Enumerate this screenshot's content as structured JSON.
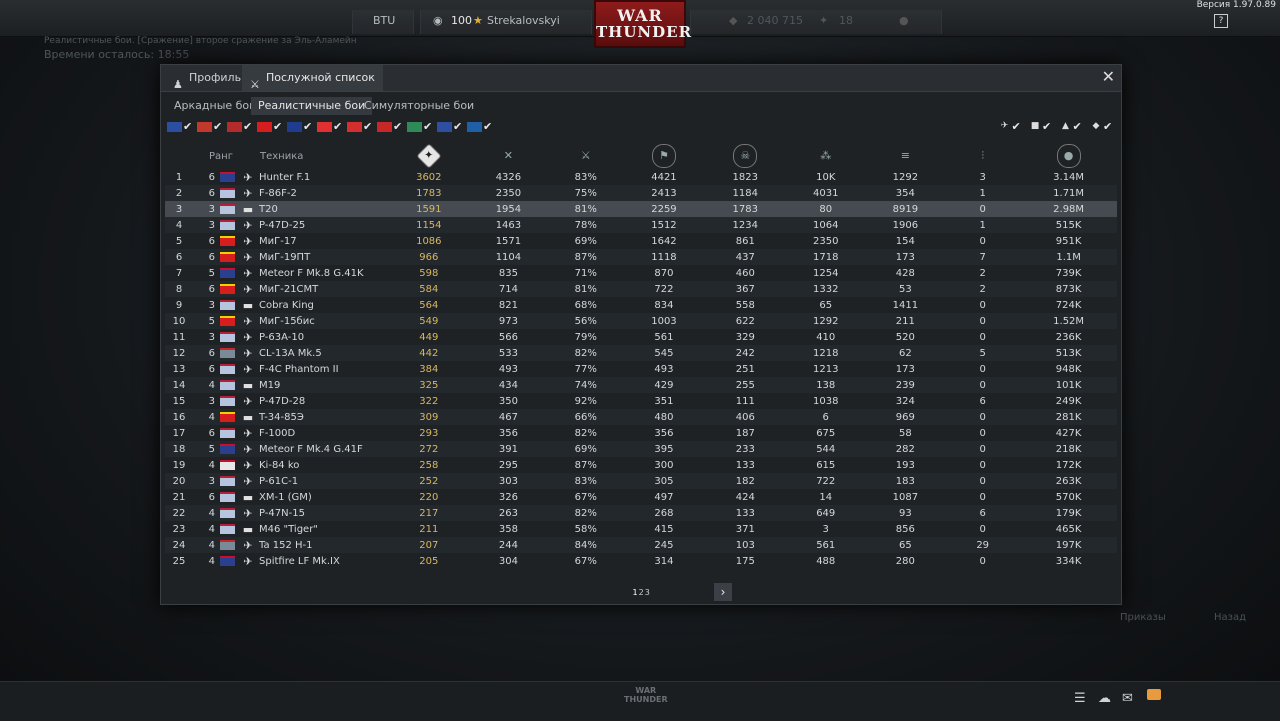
{
  "topbar": {
    "version": "Версия 1.97.0.89",
    "currency_label": "BTU",
    "player_level": "100",
    "player_name": "Strekalovskyi",
    "lions": "2 040 715",
    "eagles": "18",
    "logo_line1": "WAR",
    "logo_line2": "THUNDER",
    "help_label": "?"
  },
  "background": {
    "battle_info": "Реалистичные бои. [Сражение] второе сражение за Эль-Аламейн",
    "time_left": "Времени осталось: 18:55"
  },
  "window": {
    "tab_profile": "Профиль",
    "tab_service_record": "Послужной список",
    "mode_tabs": [
      "Аркадные бои",
      "Реалистичные бои",
      "Симуляторные бои"
    ],
    "active_mode": 1,
    "flag_colors": [
      "#2b4ea1",
      "#c0392b",
      "#b32b2b",
      "#d71e1e",
      "#203c8f",
      "#e03030",
      "#d32f2f",
      "#c62828",
      "#2e8b57",
      "#2d4ea1",
      "#1f5fa8"
    ],
    "columns": [
      "Ранг",
      "Техника"
    ],
    "pager": [
      "1",
      "2",
      "3"
    ],
    "next_label": "›"
  },
  "rows": [
    {
      "n": "1",
      "rank": "6",
      "flag": "uk",
      "type": "jet",
      "veh": "Hunter F.1",
      "c1": "3602",
      "c2": "4326",
      "c3": "83%",
      "c4": "4421",
      "c5": "1823",
      "c6": "10K",
      "c7": "1292",
      "c8": "3",
      "c9": "3.14M"
    },
    {
      "n": "2",
      "rank": "6",
      "flag": "us",
      "type": "jet",
      "veh": "F-86F-2",
      "c1": "1783",
      "c2": "2350",
      "c3": "75%",
      "c4": "2413",
      "c5": "1184",
      "c6": "4031",
      "c7": "354",
      "c8": "1",
      "c9": "1.71M"
    },
    {
      "n": "3",
      "rank": "3",
      "flag": "us",
      "type": "tank",
      "veh": "T20",
      "c1": "1591",
      "c2": "1954",
      "c3": "81%",
      "c4": "2259",
      "c5": "1783",
      "c6": "80",
      "c7": "8919",
      "c8": "0",
      "c9": "2.98M"
    },
    {
      "n": "4",
      "rank": "3",
      "flag": "us",
      "type": "prop",
      "veh": "P-47D-25",
      "c1": "1154",
      "c2": "1463",
      "c3": "78%",
      "c4": "1512",
      "c5": "1234",
      "c6": "1064",
      "c7": "1906",
      "c8": "1",
      "c9": "515K"
    },
    {
      "n": "5",
      "rank": "6",
      "flag": "cn",
      "type": "jet",
      "veh": "МиГ-17",
      "c1": "1086",
      "c2": "1571",
      "c3": "69%",
      "c4": "1642",
      "c5": "861",
      "c6": "2350",
      "c7": "154",
      "c8": "0",
      "c9": "951K"
    },
    {
      "n": "6",
      "rank": "6",
      "flag": "cn",
      "type": "jet",
      "veh": "МиГ-19ПТ",
      "c1": "966",
      "c2": "1104",
      "c3": "87%",
      "c4": "1118",
      "c5": "437",
      "c6": "1718",
      "c7": "173",
      "c8": "7",
      "c9": "1.1M"
    },
    {
      "n": "7",
      "rank": "5",
      "flag": "uk",
      "type": "prop",
      "veh": "Meteor F Mk.8 G.41K",
      "c1": "598",
      "c2": "835",
      "c3": "71%",
      "c4": "870",
      "c5": "460",
      "c6": "1254",
      "c7": "428",
      "c8": "2",
      "c9": "739K"
    },
    {
      "n": "8",
      "rank": "6",
      "flag": "cn",
      "type": "jet",
      "veh": "МиГ-21СМТ",
      "c1": "584",
      "c2": "714",
      "c3": "81%",
      "c4": "722",
      "c5": "367",
      "c6": "1332",
      "c7": "53",
      "c8": "2",
      "c9": "873K"
    },
    {
      "n": "9",
      "rank": "3",
      "flag": "us",
      "type": "tank",
      "veh": "Cobra King",
      "c1": "564",
      "c2": "821",
      "c3": "68%",
      "c4": "834",
      "c5": "558",
      "c6": "65",
      "c7": "1411",
      "c8": "0",
      "c9": "724K"
    },
    {
      "n": "10",
      "rank": "5",
      "flag": "cn",
      "type": "jet",
      "veh": "МиГ-15бис",
      "c1": "549",
      "c2": "973",
      "c3": "56%",
      "c4": "1003",
      "c5": "622",
      "c6": "1292",
      "c7": "211",
      "c8": "0",
      "c9": "1.52M"
    },
    {
      "n": "11",
      "rank": "3",
      "flag": "us",
      "type": "prop",
      "veh": "P-63A-10",
      "c1": "449",
      "c2": "566",
      "c3": "79%",
      "c4": "561",
      "c5": "329",
      "c6": "410",
      "c7": "520",
      "c8": "0",
      "c9": "236K"
    },
    {
      "n": "12",
      "rank": "6",
      "flag": "de",
      "type": "jet",
      "veh": "CL-13A Mk.5",
      "c1": "442",
      "c2": "533",
      "c3": "82%",
      "c4": "545",
      "c5": "242",
      "c6": "1218",
      "c7": "62",
      "c8": "5",
      "c9": "513K"
    },
    {
      "n": "13",
      "rank": "6",
      "flag": "us",
      "type": "jet",
      "veh": "F-4C Phantom II",
      "c1": "384",
      "c2": "493",
      "c3": "77%",
      "c4": "493",
      "c5": "251",
      "c6": "1213",
      "c7": "173",
      "c8": "0",
      "c9": "948K"
    },
    {
      "n": "14",
      "rank": "4",
      "flag": "us",
      "type": "tank",
      "veh": "M19",
      "c1": "325",
      "c2": "434",
      "c3": "74%",
      "c4": "429",
      "c5": "255",
      "c6": "138",
      "c7": "239",
      "c8": "0",
      "c9": "101K"
    },
    {
      "n": "15",
      "rank": "3",
      "flag": "us",
      "type": "prop",
      "veh": "P-47D-28",
      "c1": "322",
      "c2": "350",
      "c3": "92%",
      "c4": "351",
      "c5": "111",
      "c6": "1038",
      "c7": "324",
      "c8": "6",
      "c9": "249K"
    },
    {
      "n": "16",
      "rank": "4",
      "flag": "cn",
      "type": "tank",
      "veh": "T-34-85Э",
      "c1": "309",
      "c2": "467",
      "c3": "66%",
      "c4": "480",
      "c5": "406",
      "c6": "6",
      "c7": "969",
      "c8": "0",
      "c9": "281K"
    },
    {
      "n": "17",
      "rank": "6",
      "flag": "us",
      "type": "jet",
      "veh": "F-100D",
      "c1": "293",
      "c2": "356",
      "c3": "82%",
      "c4": "356",
      "c5": "187",
      "c6": "675",
      "c7": "58",
      "c8": "0",
      "c9": "427K"
    },
    {
      "n": "18",
      "rank": "5",
      "flag": "uk",
      "type": "prop",
      "veh": "Meteor F Mk.4 G.41F",
      "c1": "272",
      "c2": "391",
      "c3": "69%",
      "c4": "395",
      "c5": "233",
      "c6": "544",
      "c7": "282",
      "c8": "0",
      "c9": "218K"
    },
    {
      "n": "19",
      "rank": "4",
      "flag": "jp",
      "type": "prop",
      "veh": "Ki-84 ko",
      "c1": "258",
      "c2": "295",
      "c3": "87%",
      "c4": "300",
      "c5": "133",
      "c6": "615",
      "c7": "193",
      "c8": "0",
      "c9": "172K"
    },
    {
      "n": "20",
      "rank": "3",
      "flag": "us",
      "type": "prop",
      "veh": "P-61C-1",
      "c1": "252",
      "c2": "303",
      "c3": "83%",
      "c4": "305",
      "c5": "182",
      "c6": "722",
      "c7": "183",
      "c8": "0",
      "c9": "263K"
    },
    {
      "n": "21",
      "rank": "6",
      "flag": "us",
      "type": "tank",
      "veh": "XM-1 (GM)",
      "c1": "220",
      "c2": "326",
      "c3": "67%",
      "c4": "497",
      "c5": "424",
      "c6": "14",
      "c7": "1087",
      "c8": "0",
      "c9": "570K"
    },
    {
      "n": "22",
      "rank": "4",
      "flag": "us",
      "type": "prop",
      "veh": "P-47N-15",
      "c1": "217",
      "c2": "263",
      "c3": "82%",
      "c4": "268",
      "c5": "133",
      "c6": "649",
      "c7": "93",
      "c8": "6",
      "c9": "179K"
    },
    {
      "n": "23",
      "rank": "4",
      "flag": "us",
      "type": "tank",
      "veh": "M46 \"Tiger\"",
      "c1": "211",
      "c2": "358",
      "c3": "58%",
      "c4": "415",
      "c5": "371",
      "c6": "3",
      "c7": "856",
      "c8": "0",
      "c9": "465K"
    },
    {
      "n": "24",
      "rank": "4",
      "flag": "de",
      "type": "prop",
      "veh": "Ta 152 H-1",
      "c1": "207",
      "c2": "244",
      "c3": "84%",
      "c4": "245",
      "c5": "103",
      "c6": "561",
      "c7": "65",
      "c8": "29",
      "c9": "197K"
    },
    {
      "n": "25",
      "rank": "4",
      "flag": "uk",
      "type": "prop",
      "veh": "Spitfire LF Mk.IX",
      "c1": "205",
      "c2": "304",
      "c3": "67%",
      "c4": "314",
      "c5": "175",
      "c6": "488",
      "c7": "280",
      "c8": "0",
      "c9": "334K"
    }
  ],
  "side_buttons": {
    "orders": "Приказы",
    "back": "Назад"
  },
  "bottom": {
    "logo_line1": "WAR",
    "logo_line2": "THUNDER"
  }
}
